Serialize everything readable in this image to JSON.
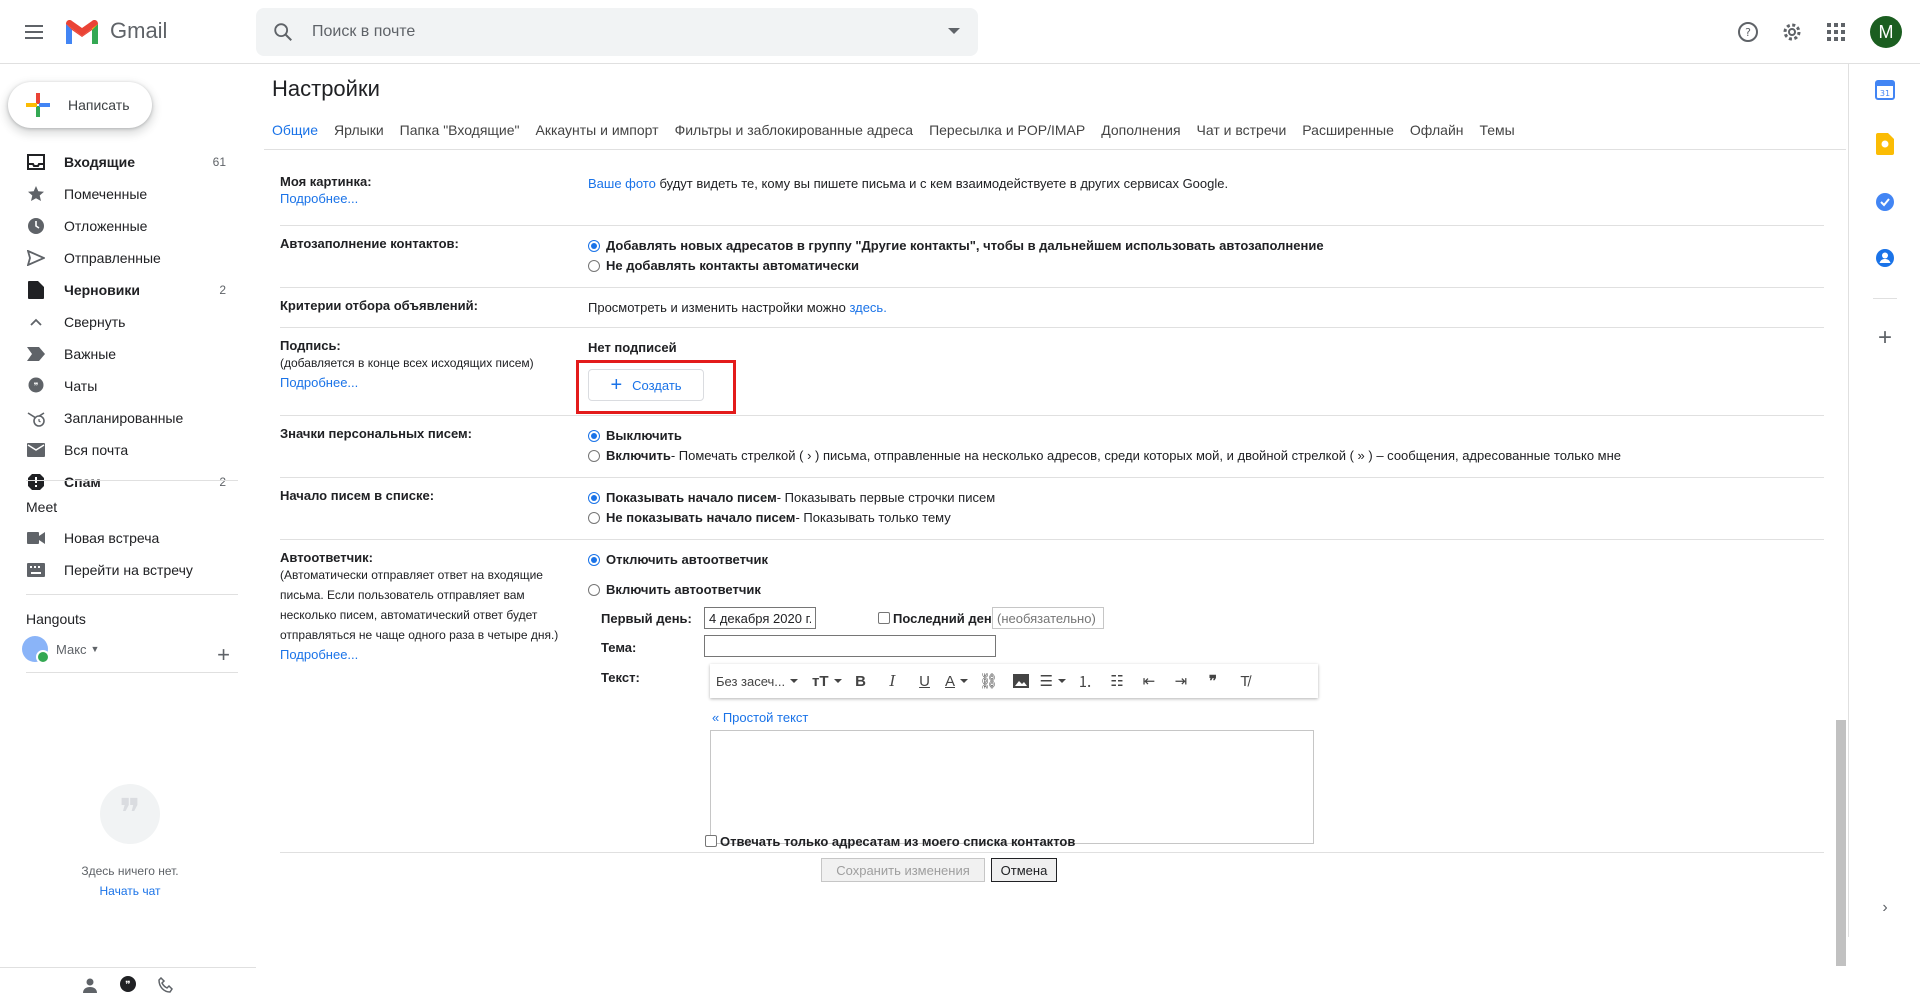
{
  "app": {
    "name": "Gmail",
    "avatar_letter": "M"
  },
  "search": {
    "placeholder": "Поиск в почте"
  },
  "compose": {
    "label": "Написать"
  },
  "nav": [
    {
      "label": "Входящие",
      "count": "61",
      "bold": true,
      "icon": "inbox-icon"
    },
    {
      "label": "Помеченные",
      "count": "",
      "bold": false,
      "icon": "star-icon"
    },
    {
      "label": "Отложенные",
      "count": "",
      "bold": false,
      "icon": "clock-icon"
    },
    {
      "label": "Отправленные",
      "count": "",
      "bold": false,
      "icon": "send-icon"
    },
    {
      "label": "Черновики",
      "count": "2",
      "bold": true,
      "icon": "draft-icon"
    },
    {
      "label": "Свернуть",
      "count": "",
      "bold": false,
      "icon": "chevron-up-icon"
    },
    {
      "label": "Важные",
      "count": "",
      "bold": false,
      "icon": "important-icon"
    },
    {
      "label": "Чаты",
      "count": "",
      "bold": false,
      "icon": "chat-icon"
    },
    {
      "label": "Запланированные",
      "count": "",
      "bold": false,
      "icon": "scheduled-icon"
    },
    {
      "label": "Вся почта",
      "count": "",
      "bold": false,
      "icon": "mail-icon"
    },
    {
      "label": "Спам",
      "count": "2",
      "bold": true,
      "icon": "spam-icon"
    }
  ],
  "meet": {
    "title": "Meet",
    "items": [
      {
        "label": "Новая встреча",
        "icon": "video-icon"
      },
      {
        "label": "Перейти на встречу",
        "icon": "keyboard-icon"
      }
    ]
  },
  "hangouts": {
    "title": "Hangouts",
    "user": "Макс",
    "empty": "Здесь ничего нет.",
    "start_chat": "Начать чат"
  },
  "page_title": "Настройки",
  "tabs": [
    "Общие",
    "Ярлыки",
    "Папка \"Входящие\"",
    "Аккаунты и импорт",
    "Фильтры и заблокированные адреса",
    "Пересылка и POP/IMAP",
    "Дополнения",
    "Чат и встречи",
    "Расширенные",
    "Офлайн",
    "Темы"
  ],
  "settings": {
    "picture": {
      "label": "Моя картинка:",
      "more": "Подробнее...",
      "link": "Ваше фото",
      "text": " будут видеть те, кому вы пишете письма и с кем взаимодействуете в других сервисах Google."
    },
    "autocomplete": {
      "label": "Автозаполнение контактов:",
      "opt1": "Добавлять новых адресатов в группу \"Другие контакты\", чтобы в дальнейшем использовать автозаполнение",
      "opt2": "Не добавлять контакты автоматически"
    },
    "ads": {
      "label": "Критерии отбора объявлений:",
      "text": "Просмотреть и изменить настройки можно ",
      "link": "здесь",
      "dot": "."
    },
    "signature": {
      "label": "Подпись:",
      "sub": "(добавляется в конце всех исходящих писем)",
      "more": "Подробнее...",
      "none": "Нет подписей",
      "create": "Создать"
    },
    "personal": {
      "label": "Значки персональных писем:",
      "opt1": "Выключить",
      "opt2": "Включить",
      "opt2_desc": " - Помечать стрелкой ( › ) письма, отправленные на несколько адресов, среди которых мой, и двойной стрелкой ( » ) – сообщения, адресованные только мне"
    },
    "snippets": {
      "label": "Начало писем в списке:",
      "opt1": "Показывать начало писем",
      "opt1_desc": " - Показывать первые строчки писем",
      "opt2": "Не показывать начало писем",
      "opt2_desc": " - Показывать только тему"
    },
    "vacation": {
      "label": "Автоответчик:",
      "sub": "(Автоматически отправляет ответ на входящие письма. Если пользователь отправляет вам несколько писем, автоматический ответ будет отправляться не чаще одного раза в четыре дня.)",
      "more": "Подробнее...",
      "opt1": "Отключить автоответчик",
      "opt2": "Включить автоответчик",
      "first_day_label": "Первый день:",
      "first_day": "4 декабря 2020 г.",
      "last_day_label": "Последний день:",
      "last_day_placeholder": "(необязательно)",
      "subject_label": "Тема:",
      "text_label": "Текст:",
      "font": "Без засеч...",
      "plain_text": "« Простой текст",
      "contacts_only": "Отвечать только адресатам из моего списка контактов"
    }
  },
  "buttons": {
    "save": "Сохранить изменения",
    "cancel": "Отмена"
  },
  "colors": {
    "accent": "#1a73e8",
    "highlight": "#e31b1b"
  }
}
